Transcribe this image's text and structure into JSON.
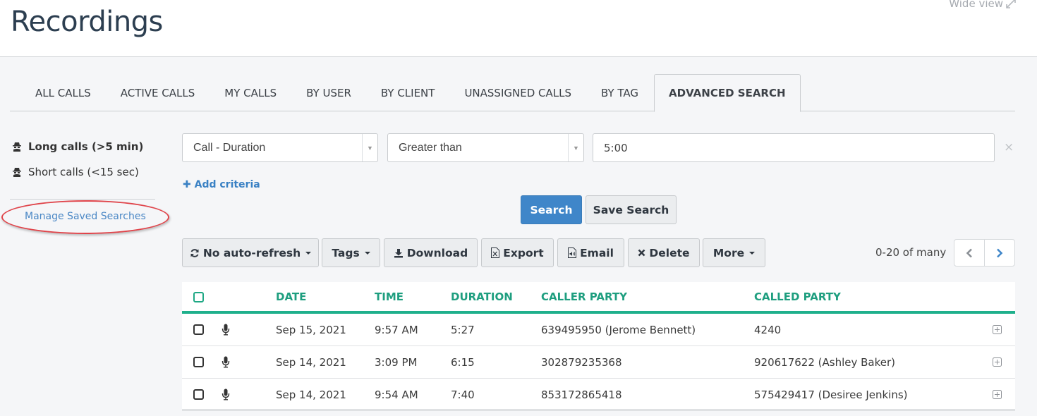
{
  "header": {
    "title": "Recordings",
    "wide_view_label": "Wide view"
  },
  "tabs": [
    {
      "label": "ALL CALLS",
      "active": false
    },
    {
      "label": "ACTIVE CALLS",
      "active": false
    },
    {
      "label": "MY CALLS",
      "active": false
    },
    {
      "label": "BY USER",
      "active": false
    },
    {
      "label": "BY CLIENT",
      "active": false
    },
    {
      "label": "UNASSIGNED CALLS",
      "active": false
    },
    {
      "label": "BY TAG",
      "active": false
    },
    {
      "label": "ADVANCED SEARCH",
      "active": true
    }
  ],
  "sidebar": {
    "saved_searches": [
      {
        "label": "Long calls (>5 min)",
        "icon": "spy-icon",
        "active": true
      },
      {
        "label": "Short calls (<15 sec)",
        "icon": "spy-icon",
        "active": false
      }
    ],
    "manage_link": "Manage Saved Searches"
  },
  "criteria": {
    "field": "Call - Duration",
    "operator": "Greater than",
    "value": "5:00",
    "remove_symbol": "×",
    "add_label": "Add criteria"
  },
  "actions": {
    "search_label": "Search",
    "save_search_label": "Save Search"
  },
  "toolbar": {
    "auto_refresh_label": "No auto-refresh",
    "tags_label": "Tags",
    "download_label": "Download",
    "export_label": "Export",
    "email_label": "Email",
    "delete_label": "Delete",
    "more_label": "More"
  },
  "pagination": {
    "range_text": "0-20 of many"
  },
  "table": {
    "columns": [
      "DATE",
      "TIME",
      "DURATION",
      "CALLER PARTY",
      "CALLED PARTY"
    ],
    "rows": [
      {
        "date": "Sep 15, 2021",
        "time": "9:57 AM",
        "duration": "5:27",
        "caller": "639495950 (Jerome Bennett)",
        "called": "4240"
      },
      {
        "date": "Sep 14, 2021",
        "time": "3:09 PM",
        "duration": "6:15",
        "caller": "302879235368",
        "called": "920617622 (Ashley Baker)"
      },
      {
        "date": "Sep 14, 2021",
        "time": "9:54 AM",
        "duration": "7:40",
        "caller": "853172865418",
        "called": "575429417 (Desiree Jenkins)"
      }
    ]
  },
  "colors": {
    "accent_teal": "#1fb08c",
    "primary_blue": "#3f86c9",
    "link_blue": "#4a87c5",
    "annotation_red": "#e0444a"
  }
}
